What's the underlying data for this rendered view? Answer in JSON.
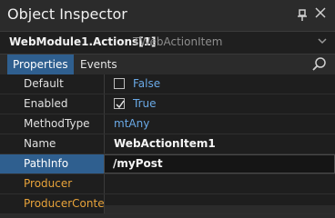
{
  "window": {
    "title": "Object Inspector"
  },
  "object_selector": {
    "name": "WebModule1.Actions[1]",
    "type": "TWebActionItem"
  },
  "tabs": [
    {
      "label": "Properties"
    },
    {
      "label": "Events"
    }
  ],
  "properties": [
    {
      "name": "Default",
      "value": "False",
      "checkbox": true,
      "checked": false
    },
    {
      "name": "Enabled",
      "value": "True",
      "checkbox": true,
      "checked": true
    },
    {
      "name": "MethodType",
      "value": "mtAny"
    },
    {
      "name": "Name",
      "value": "WebActionItem1"
    },
    {
      "name": "PathInfo",
      "value": "/myPost",
      "selected": true
    },
    {
      "name": "Producer",
      "value": ""
    },
    {
      "name": "ProducerConten",
      "value": ""
    }
  ],
  "colors": {
    "accent": "#2f5f8f",
    "link_value": "#6aa9e6",
    "event_property": "#e8a33a"
  }
}
